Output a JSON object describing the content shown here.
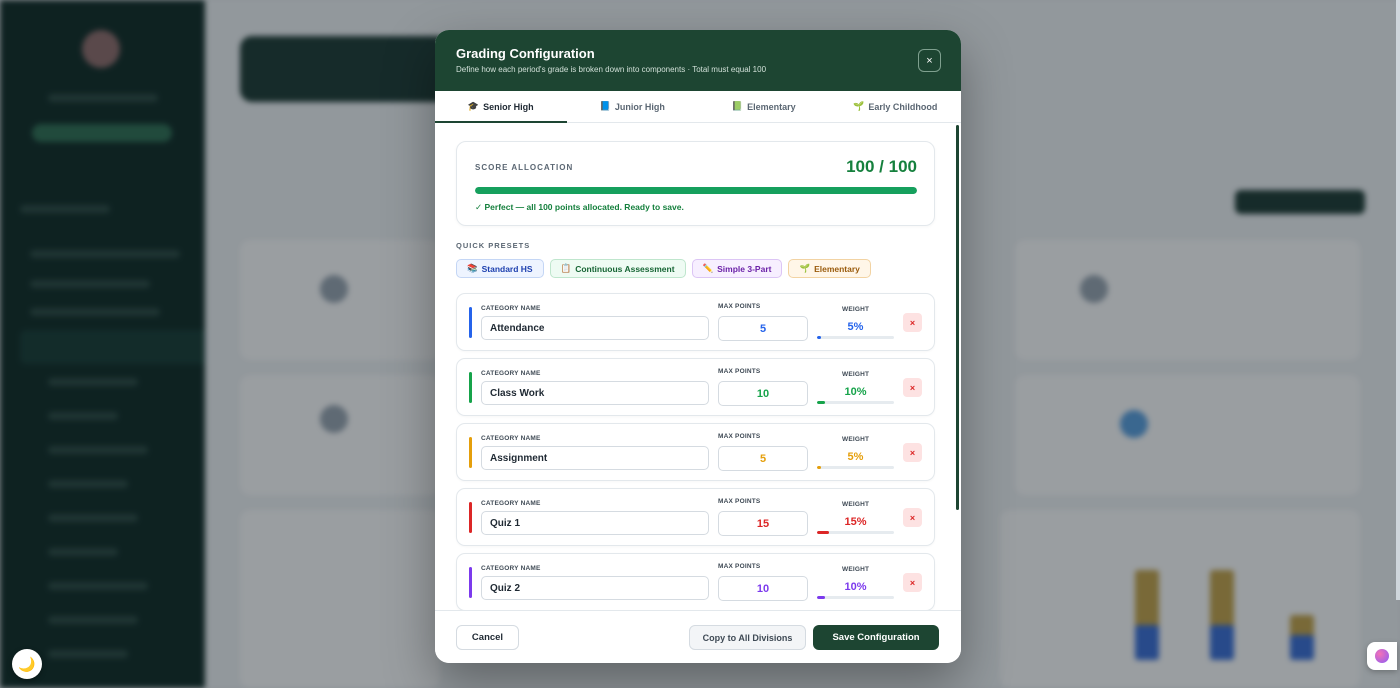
{
  "modal": {
    "title": "Grading Configuration",
    "subtitle": "Define how each period's grade is broken down into components · Total must equal 100",
    "close_label": "×"
  },
  "tabs": [
    {
      "label": "Senior High",
      "icon": "🎓",
      "icon_name": "graduation-cap-icon",
      "active": true
    },
    {
      "label": "Junior High",
      "icon": "📘",
      "icon_name": "blue-book-icon",
      "active": false
    },
    {
      "label": "Elementary",
      "icon": "📗",
      "icon_name": "green-book-icon",
      "active": false
    },
    {
      "label": "Early Childhood",
      "icon": "🌱",
      "icon_name": "seedling-icon",
      "active": false
    }
  ],
  "allocation": {
    "label": "SCORE ALLOCATION",
    "total_text": "100 / 100",
    "progress_fraction": 1.0,
    "message": "✓ Perfect — all 100 points allocated. Ready to save."
  },
  "presets": {
    "label": "QUICK PRESETS",
    "items": [
      {
        "label": "Standard HS",
        "icon": "📚",
        "icon_name": "books-icon",
        "style": "blue"
      },
      {
        "label": "Continuous Assessment",
        "icon": "📋",
        "icon_name": "clipboard-icon",
        "style": "green"
      },
      {
        "label": "Simple 3-Part",
        "icon": "✏️",
        "icon_name": "pencil-icon",
        "style": "purple"
      },
      {
        "label": "Elementary",
        "icon": "🌱",
        "icon_name": "seedling-icon",
        "style": "orange"
      }
    ]
  },
  "field_labels": {
    "category_name": "CATEGORY NAME",
    "max_points": "MAX POINTS",
    "weight": "WEIGHT"
  },
  "categories": [
    {
      "name": "Attendance",
      "points": "5",
      "weight": "5%",
      "weight_fraction": 0.05,
      "color": "#2563eb"
    },
    {
      "name": "Class Work",
      "points": "10",
      "weight": "10%",
      "weight_fraction": 0.1,
      "color": "#16a34a"
    },
    {
      "name": "Assignment",
      "points": "5",
      "weight": "5%",
      "weight_fraction": 0.05,
      "color": "#e59f0b"
    },
    {
      "name": "Quiz 1",
      "points": "15",
      "weight": "15%",
      "weight_fraction": 0.15,
      "color": "#dc2626"
    },
    {
      "name": "Quiz 2",
      "points": "10",
      "weight": "10%",
      "weight_fraction": 0.1,
      "color": "#7c3aed"
    }
  ],
  "delete_label": "×",
  "footer": {
    "cancel_label": "Cancel",
    "copy_label": "Copy to All Divisions",
    "save_label": "Save Configuration"
  },
  "floating": {
    "theme_icon": "🌙"
  },
  "colors": {
    "brand": "#1d4532",
    "success": "#15803d"
  }
}
